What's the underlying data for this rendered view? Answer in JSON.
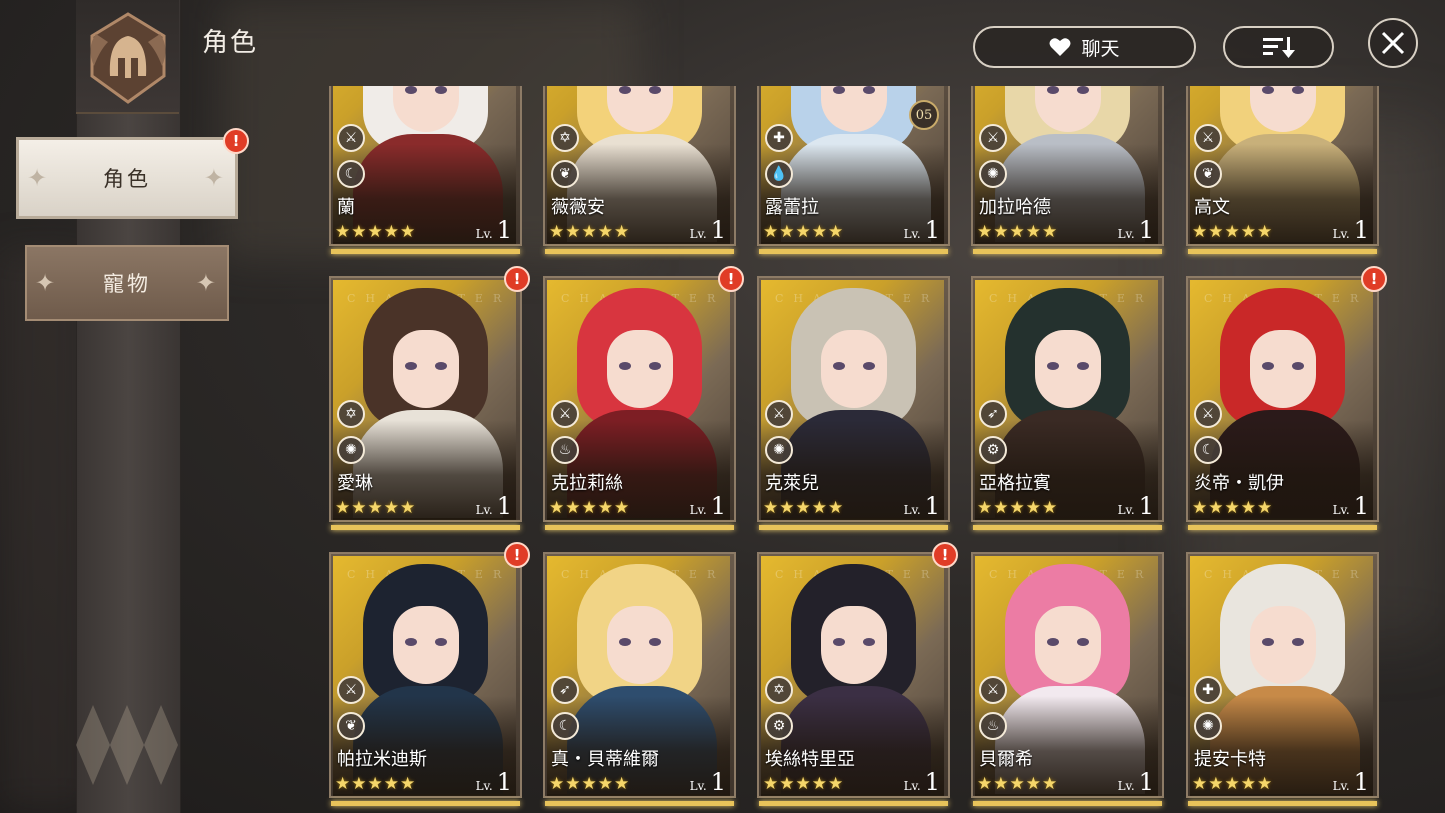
{
  "page": {
    "title": "角色"
  },
  "top": {
    "chat_label": "聊天"
  },
  "tabs": [
    {
      "label": "角色",
      "active": true,
      "alert": "!"
    },
    {
      "label": "寵物",
      "active": false
    }
  ],
  "level_prefix": "Lv.",
  "colors": {
    "accent_gold": "#e8c35a",
    "alert_red": "#e03c26",
    "star": "#f5d66a"
  },
  "characters": [
    {
      "name": "蘭",
      "stars": "★★★★★",
      "level": "1",
      "class_icon": "sword-icon",
      "element_icon": "moon-icon"
    },
    {
      "name": "薇薇安",
      "stars": "★★★★★",
      "level": "1",
      "class_icon": "hexagram-icon",
      "element_icon": "leaf-icon"
    },
    {
      "name": "露蕾拉",
      "stars": "★★★★★",
      "level": "1",
      "class_icon": "cross-icon",
      "element_icon": "water-drop-icon",
      "badge": "05"
    },
    {
      "name": "加拉哈德",
      "stars": "★★★★★",
      "level": "1",
      "class_icon": "sword-icon",
      "element_icon": "sun-icon"
    },
    {
      "name": "高文",
      "stars": "★★★★★",
      "level": "1",
      "class_icon": "sword-icon",
      "element_icon": "leaf-icon"
    },
    {
      "name": "愛琳",
      "stars": "★★★★★",
      "level": "1",
      "class_icon": "hexagram-icon",
      "element_icon": "sun-icon",
      "alert": "!"
    },
    {
      "name": "克拉莉絲",
      "stars": "★★★★★",
      "level": "1",
      "class_icon": "sword-icon",
      "element_icon": "fire-icon",
      "alert": "!"
    },
    {
      "name": "克萊兒",
      "stars": "★★★★★",
      "level": "1",
      "class_icon": "sword-icon",
      "element_icon": "sun-icon"
    },
    {
      "name": "亞格拉賓",
      "stars": "★★★★★",
      "level": "1",
      "class_icon": "bow-icon",
      "element_icon": "gear-icon"
    },
    {
      "name": "炎帝・凱伊",
      "stars": "★★★★★",
      "level": "1",
      "class_icon": "sword-icon",
      "element_icon": "moon-icon",
      "alert": "!"
    },
    {
      "name": "帕拉米迪斯",
      "stars": "★★★★★",
      "level": "1",
      "class_icon": "sword-icon",
      "element_icon": "leaf-icon",
      "alert": "!"
    },
    {
      "name": "真・貝蒂維爾",
      "stars": "★★★★★",
      "level": "1",
      "class_icon": "bow-icon",
      "element_icon": "moon-icon"
    },
    {
      "name": "埃絲特里亞",
      "stars": "★★★★★",
      "level": "1",
      "class_icon": "hexagram-icon",
      "element_icon": "gear-icon",
      "alert": "!"
    },
    {
      "name": "貝爾希",
      "stars": "★★★★★",
      "level": "1",
      "class_icon": "sword-icon",
      "element_icon": "fire-icon"
    },
    {
      "name": "提安卡特",
      "stars": "★★★★★",
      "level": "1",
      "class_icon": "cross-icon",
      "element_icon": "sun-icon"
    }
  ]
}
